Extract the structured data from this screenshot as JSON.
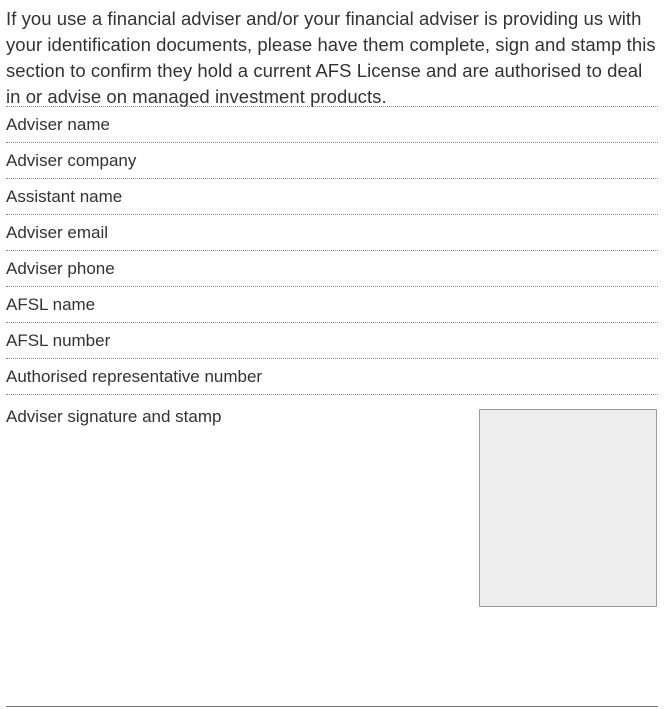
{
  "intro": {
    "text": "If you use a financial adviser and/or your financial adviser is providing us with your identification documents, please have them complete, sign and stamp this section to confirm they hold a current AFS License and are authorised to deal in or advise on managed investment products."
  },
  "fields": [
    {
      "label": "Adviser name"
    },
    {
      "label": "Adviser company"
    },
    {
      "label": "Assistant name"
    },
    {
      "label": "Adviser email"
    },
    {
      "label": "Adviser phone"
    },
    {
      "label": "AFSL name"
    },
    {
      "label": "AFSL number"
    },
    {
      "label": "Authorised representative number"
    }
  ],
  "signature": {
    "label": "Adviser signature and stamp"
  },
  "colors": {
    "text": "#333333",
    "dotted_rule": "#8a8a8a",
    "stamp_box_fill": "#ededed",
    "stamp_box_border": "#9a9a9a"
  }
}
